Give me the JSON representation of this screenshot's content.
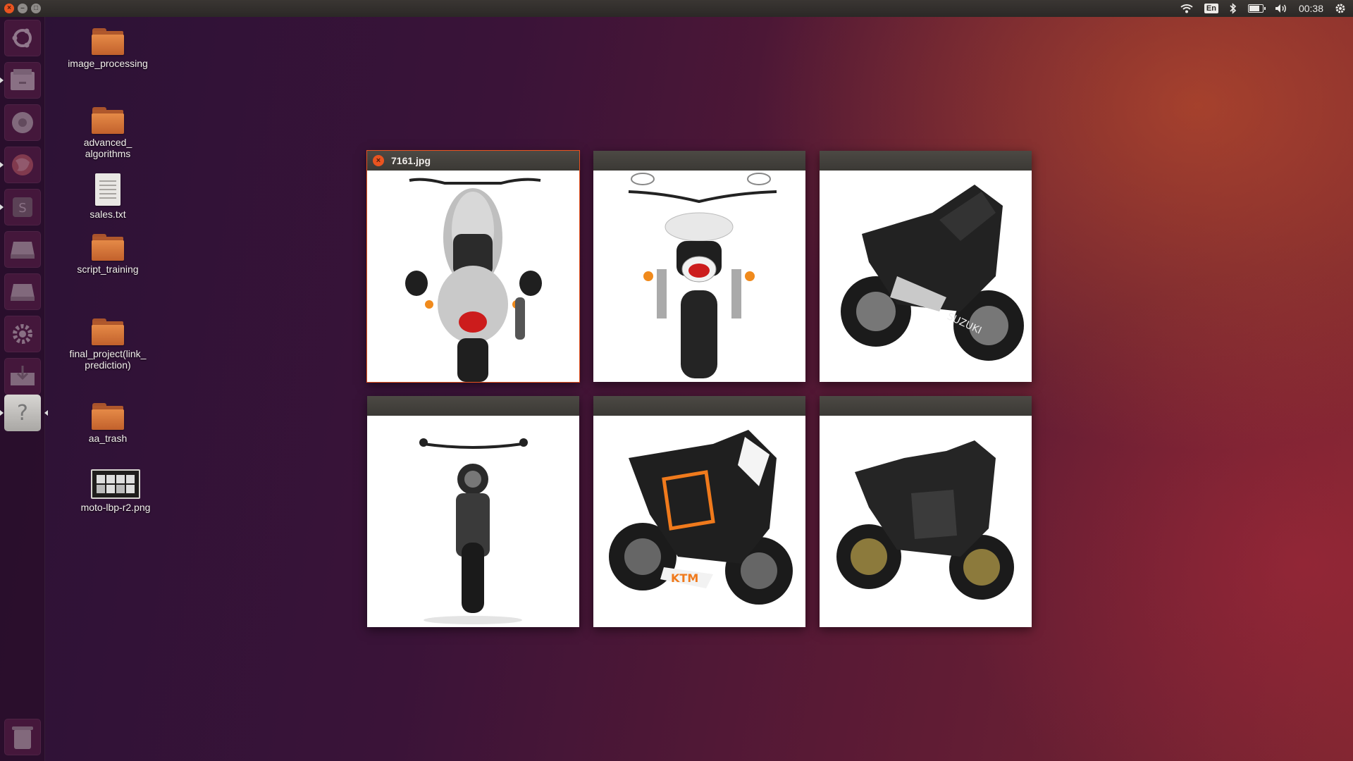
{
  "top_panel": {
    "window_buttons": [
      "close",
      "minimize",
      "maximize"
    ],
    "indicators": {
      "wifi_icon": "wifi-icon",
      "keyboard_layout": "En",
      "bluetooth_icon": "bluetooth-icon",
      "battery_icon": "battery-icon",
      "volume_icon": "volume-icon",
      "clock": "00:38",
      "session_icon": "gear-icon"
    }
  },
  "launcher": {
    "items": [
      {
        "name": "ubuntu-dash",
        "icon": "ubuntu-logo-icon"
      },
      {
        "name": "files",
        "icon": "file-manager-icon"
      },
      {
        "name": "browser",
        "icon": "chromium-icon"
      },
      {
        "name": "firefox",
        "icon": "firefox-icon"
      },
      {
        "name": "sublime-text",
        "icon": "sublime-icon"
      },
      {
        "name": "drive-1",
        "icon": "drive-icon"
      },
      {
        "name": "drive-2",
        "icon": "drive-icon"
      },
      {
        "name": "system-settings",
        "icon": "gear-icon"
      },
      {
        "name": "downloads",
        "icon": "download-icon"
      },
      {
        "name": "help",
        "icon": "question-icon",
        "active": true
      },
      {
        "name": "trash",
        "icon": "trash-icon"
      }
    ]
  },
  "desktop": {
    "icons": [
      {
        "label": "image_processing",
        "type": "folder"
      },
      {
        "label": "advanced_\nalgorithms",
        "type": "folder"
      },
      {
        "label": "sales.txt",
        "type": "text-file"
      },
      {
        "label": "script_training",
        "type": "folder"
      },
      {
        "label": "final_project(link_\nprediction)",
        "type": "folder"
      },
      {
        "label": "aa_trash",
        "type": "folder"
      },
      {
        "label": "moto-lbp-r2.png",
        "type": "image-file"
      }
    ]
  },
  "spread": {
    "windows": [
      {
        "title": "7161.jpg",
        "content": "motorcycle-rear-view",
        "focused": true
      },
      {
        "title": "",
        "content": "motorcycle-rear-view"
      },
      {
        "title": "",
        "content": "sport-motorcycle-side-view"
      },
      {
        "title": "",
        "content": "motorcycle-front-view"
      },
      {
        "title": "",
        "content": "sport-motorcycle-side-view"
      },
      {
        "title": "",
        "content": "sport-motorcycle-side-view"
      }
    ]
  },
  "colors": {
    "accent": "#e95420",
    "panel": "#2b2826",
    "titlebar": "#3b3935"
  }
}
